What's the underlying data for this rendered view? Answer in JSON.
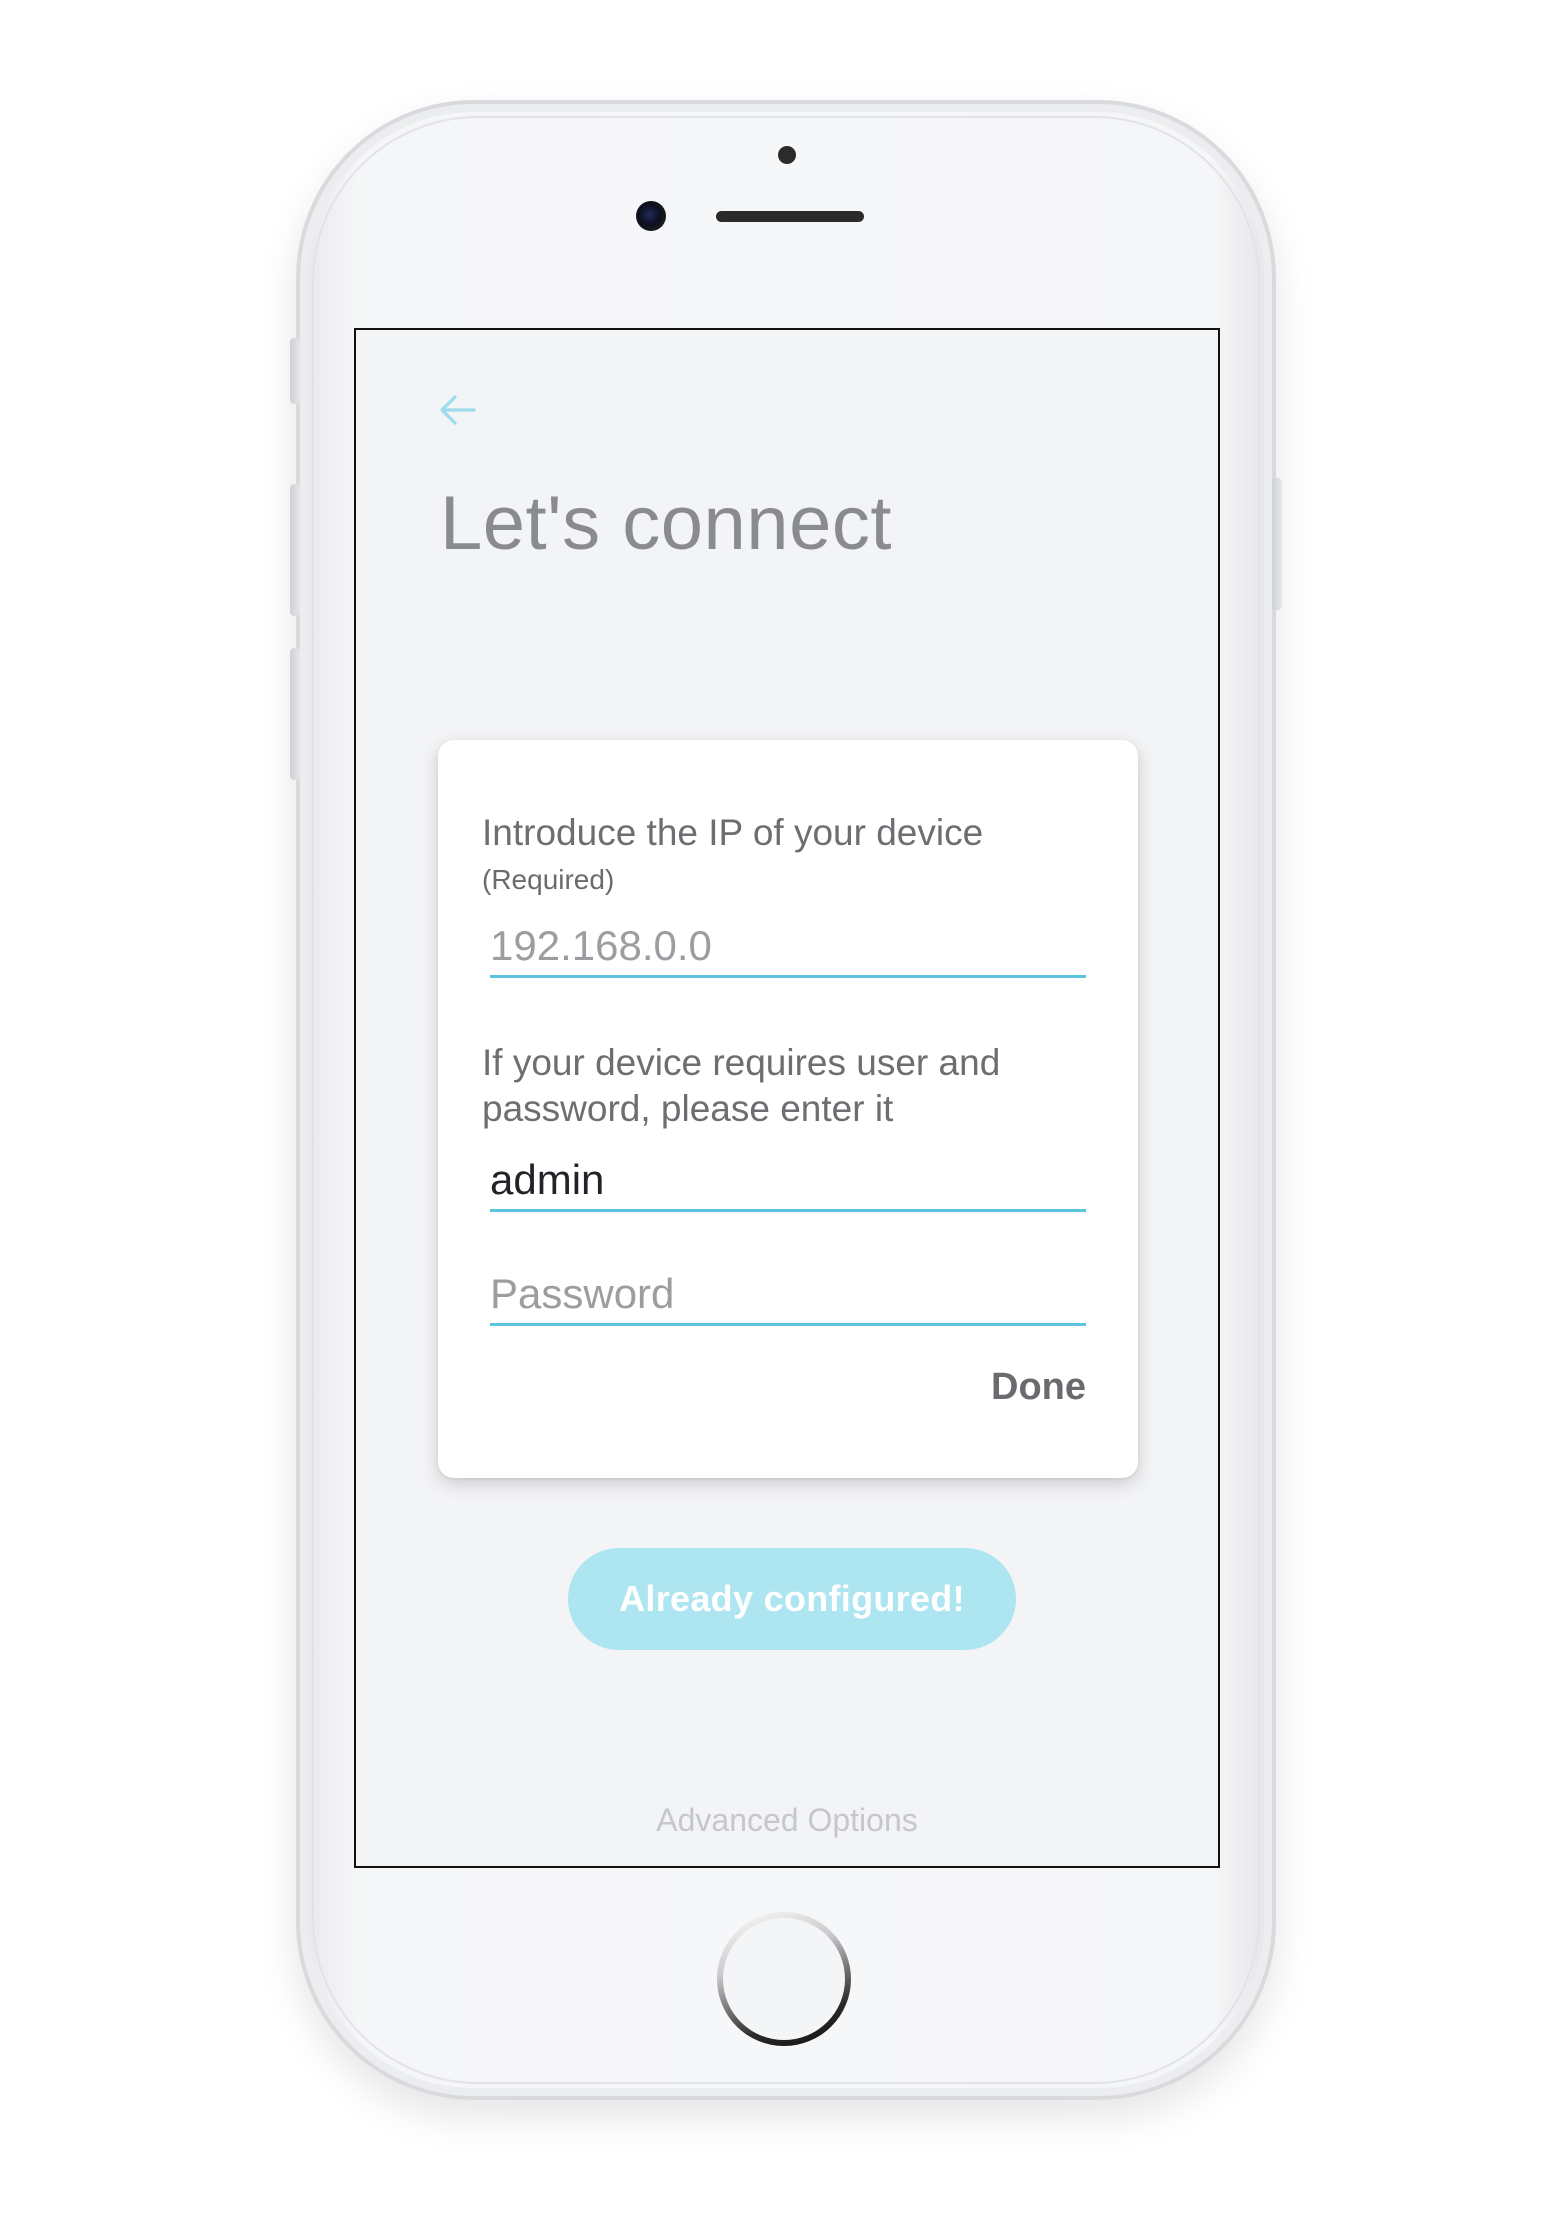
{
  "device": {
    "frame": "white smartphone",
    "icons": {
      "camera": "front-camera-icon",
      "speaker": "earpiece-speaker-icon",
      "home": "home-button"
    }
  },
  "screen": {
    "header": {
      "back_icon": "arrow-left-icon",
      "title": "Let's connect"
    },
    "card": {
      "ip_label": "Introduce the IP of your device",
      "ip_required": "(Required)",
      "ip_placeholder": "192.168.0.0",
      "ip_value": "",
      "auth_label_line1": "If your device requires user and",
      "auth_label_line2": "password, please enter it",
      "username_value": "admin",
      "password_placeholder": "Password",
      "password_value": "",
      "done_label": "Done"
    },
    "primary_button_label": "Already configured!",
    "advanced_link": "Advanced Options"
  },
  "colors": {
    "accent": "#5cc3dc",
    "button_fill": "#ade5f1",
    "title_text": "#8a8b8f",
    "screen_background": "#f3f4f6",
    "card_background": "#ffffff"
  }
}
